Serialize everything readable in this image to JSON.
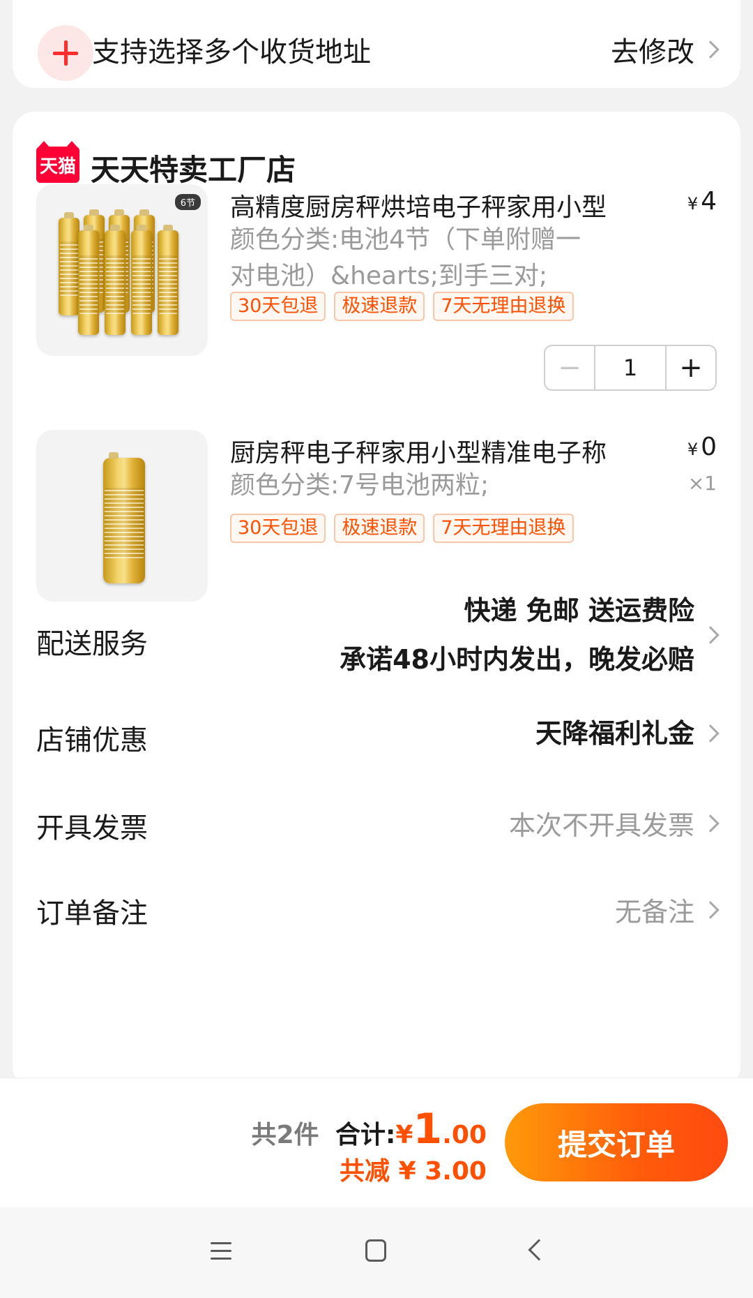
{
  "address_bar": {
    "text": "支持选择多个收货地址",
    "action": "去修改"
  },
  "shop": {
    "badge": "天猫",
    "name": "天天特卖工厂店"
  },
  "products": [
    {
      "title": "高精度厨房秤烘培电子秤家用小型",
      "currency": "¥",
      "price": "4",
      "spec": "颜色分类:电池4节（下单附赠一对电池）&hearts;到手三对;",
      "image_tag": "6节",
      "badges": [
        "30天包退",
        "极速退款",
        "7天无理由退换"
      ],
      "quantity": "1"
    },
    {
      "title": "厨房秤电子秤家用小型精准电子称",
      "currency": "¥",
      "price": "0",
      "spec": "颜色分类:7号电池两粒;",
      "quantity_label": "×1",
      "badges": [
        "30天包退",
        "极速退款",
        "7天无理由退换"
      ]
    }
  ],
  "rows": {
    "delivery": {
      "label": "配送服务",
      "value_line1": "快递 免邮 送运费险",
      "value_line2": "承诺48小时内发出，晚发必赔"
    },
    "discount": {
      "label": "店铺优惠",
      "value": "天降福利礼金"
    },
    "invoice": {
      "label": "开具发票",
      "value": "本次不开具发票"
    },
    "remark": {
      "label": "订单备注",
      "value": "无备注"
    }
  },
  "bottom": {
    "count_text": "共2件",
    "total_label": "合计:",
    "total_currency": "¥",
    "total_int": "1",
    "total_dec": ".00",
    "savings_text": "共减 ¥ 3.00",
    "submit_label": "提交订单"
  },
  "colors": {
    "accent": "#ff5000",
    "tmall_red": "#ff0036",
    "button_gradient_start": "#ff9a0a",
    "button_gradient_end": "#ff4a10"
  },
  "icons": {
    "address_add": "plus-circle-icon",
    "chevron": "chevron-right-icon",
    "nav_menu": "menu-icon",
    "nav_home": "home-square-icon",
    "nav_back": "back-arrow-icon"
  }
}
